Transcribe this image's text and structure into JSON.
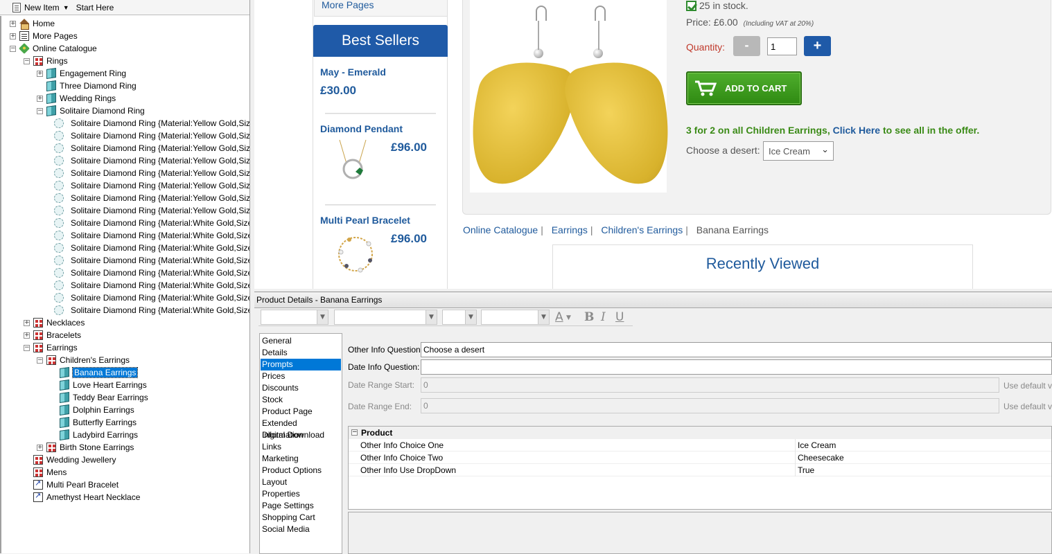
{
  "toolbar": {
    "new_item": "New Item",
    "start_here": "Start Here"
  },
  "tree": {
    "home": "Home",
    "more_pages": "More Pages",
    "online_catalogue": "Online Catalogue",
    "rings": "Rings",
    "engagement_ring": "Engagement Ring",
    "three_diamond_ring": "Three Diamond Ring",
    "wedding_rings": "Wedding Rings",
    "solitaire_diamond_ring": "Solitaire Diamond Ring",
    "variants": [
      "Solitaire Diamond Ring {Material:Yellow Gold,Size:",
      "Solitaire Diamond Ring {Material:Yellow Gold,Size:",
      "Solitaire Diamond Ring {Material:Yellow Gold,Size:",
      "Solitaire Diamond Ring {Material:Yellow Gold,Size:",
      "Solitaire Diamond Ring {Material:Yellow Gold,Size:",
      "Solitaire Diamond Ring {Material:Yellow Gold,Size:",
      "Solitaire Diamond Ring {Material:Yellow Gold,Size:",
      "Solitaire Diamond Ring {Material:Yellow Gold,Size:",
      "Solitaire Diamond Ring {Material:White Gold,Size:",
      "Solitaire Diamond Ring {Material:White Gold,Size:",
      "Solitaire Diamond Ring {Material:White Gold,Size:",
      "Solitaire Diamond Ring {Material:White Gold,Size:",
      "Solitaire Diamond Ring {Material:White Gold,Size:",
      "Solitaire Diamond Ring {Material:White Gold,Size:",
      "Solitaire Diamond Ring {Material:White Gold,Size:",
      "Solitaire Diamond Ring {Material:White Gold,Size:"
    ],
    "necklaces": "Necklaces",
    "bracelets": "Bracelets",
    "earrings": "Earrings",
    "childrens_earrings": "Children's Earrings",
    "banana_earrings": "Banana Earrings",
    "love_heart_earrings": "Love Heart Earrings",
    "teddy_bear_earrings": "Teddy Bear Earrings",
    "dolphin_earrings": "Dolphin Earrings",
    "butterfly_earrings": "Butterfly Earrings",
    "ladybird_earrings": "Ladybird Earrings",
    "birth_stone_earrings": "Birth Stone Earrings",
    "wedding_jewellery": "Wedding Jewellery",
    "mens": "Mens",
    "multi_pearl_bracelet": "Multi Pearl Bracelet",
    "amethyst_heart_necklace": "Amethyst Heart Necklace"
  },
  "web": {
    "more_pages": "More Pages",
    "best_sellers_title": "Best Sellers",
    "best_sellers": [
      {
        "name": "May - Emerald",
        "price": "£30.00"
      },
      {
        "name": "Diamond Pendant",
        "price": "£96.00"
      },
      {
        "name": "Multi Pearl Bracelet",
        "price": "£96.00"
      }
    ],
    "stock": "25 in stock.",
    "price_label": "Price:",
    "price_value": "£6.00",
    "vat_note": "(Including VAT at 20%)",
    "quantity_label": "Quantity:",
    "minus": "-",
    "plus": "+",
    "quantity_value": "1",
    "add_to_cart": "ADD TO CART",
    "offer_prefix": "3 for 2 on all Children Earrings,",
    "offer_link": "Click Here",
    "offer_suffix": "to see all in the offer.",
    "desert_label": "Choose a desert:",
    "desert_value": "Ice Cream",
    "breadcrumbs": [
      "Online Catalogue",
      "Earrings",
      "Children's Earrings"
    ],
    "breadcrumb_current": "Banana Earrings",
    "recently_viewed": "Recently Viewed"
  },
  "details": {
    "title": "Product Details - Banana Earrings",
    "nav": [
      "General",
      "Details",
      "Prompts",
      "Prices",
      "Discounts",
      "Stock",
      "Product Page",
      "Extended Information",
      "Digital Download",
      "Links",
      "Marketing",
      "Product Options",
      "Layout",
      "Properties",
      "Page Settings",
      "Shopping Cart",
      "Social Media"
    ],
    "nav_selected": "Prompts",
    "other_info_question_label": "Other Info Question:",
    "other_info_question_value": "Choose a desert",
    "date_info_question_label": "Date Info Question:",
    "date_info_question_value": "",
    "date_range_start_label": "Date Range Start:",
    "date_range_start_value": "0",
    "date_range_end_label": "Date Range End:",
    "date_range_end_value": "0",
    "use_default_1": "Use default va",
    "use_default_2": "Use default va",
    "grid_category": "Product",
    "grid_rows": [
      {
        "key": "Other Info Choice One",
        "value": "Ice Cream"
      },
      {
        "key": "Other Info Choice Two",
        "value": "Cheesecake"
      },
      {
        "key": "Other Info Use DropDown",
        "value": "True"
      }
    ]
  }
}
